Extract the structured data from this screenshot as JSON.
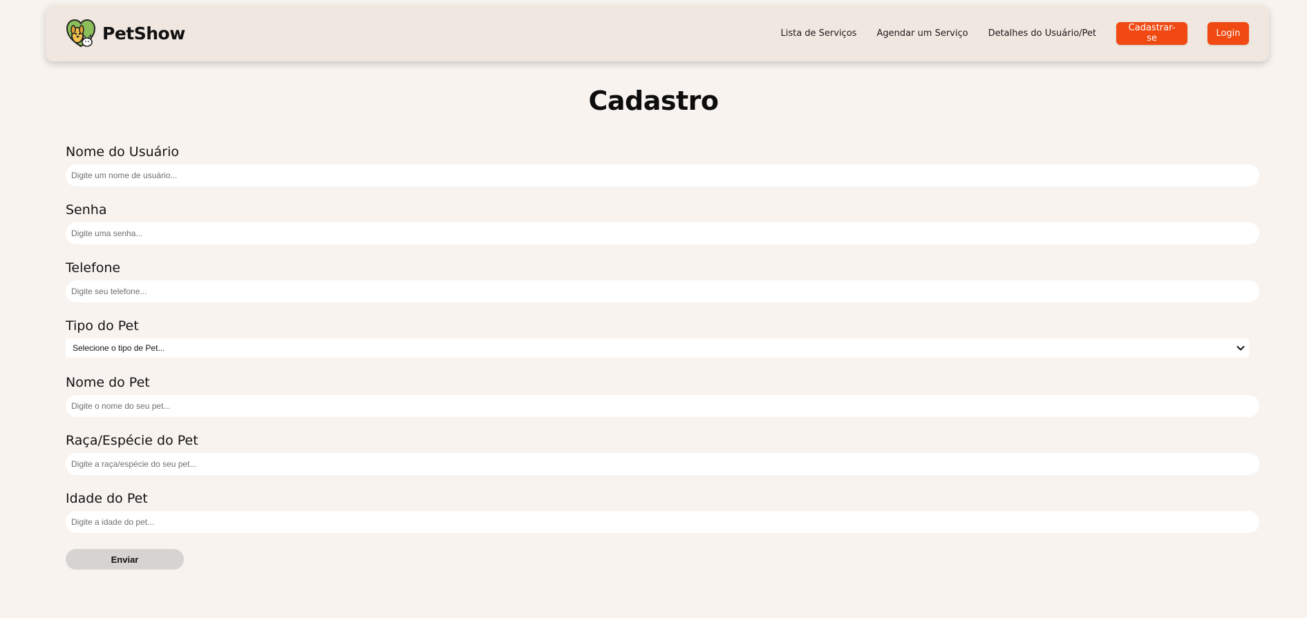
{
  "brand": {
    "name": "PetShow",
    "logo_icon": "dog-cat-heart-logo"
  },
  "nav": {
    "links": [
      "Lista de Serviços",
      "Agendar um Serviço",
      "Detalhes do Usuário/Pet"
    ],
    "signup_label": "Cadastrar-se",
    "login_label": "Login",
    "accent_color": "#f04a12"
  },
  "page": {
    "title": "Cadastro"
  },
  "form": {
    "username": {
      "label": "Nome do Usuário",
      "placeholder": "Digite um nome de usuário..."
    },
    "password": {
      "label": "Senha",
      "placeholder": "Digite uma senha..."
    },
    "phone": {
      "label": "Telefone",
      "placeholder": "Digite seu telefone..."
    },
    "pet_type": {
      "label": "Tipo do Pet",
      "selected": "Selecione o tipo de Pet..."
    },
    "pet_name": {
      "label": "Nome do Pet",
      "placeholder": "Digite o nome do seu pet..."
    },
    "pet_breed": {
      "label": "Raça/Espécie do Pet",
      "placeholder": "Digite a raça/espécie do seu pet..."
    },
    "pet_age": {
      "label": "Idade do Pet",
      "placeholder": "Digite a idade do pet..."
    },
    "submit_label": "Enviar"
  }
}
